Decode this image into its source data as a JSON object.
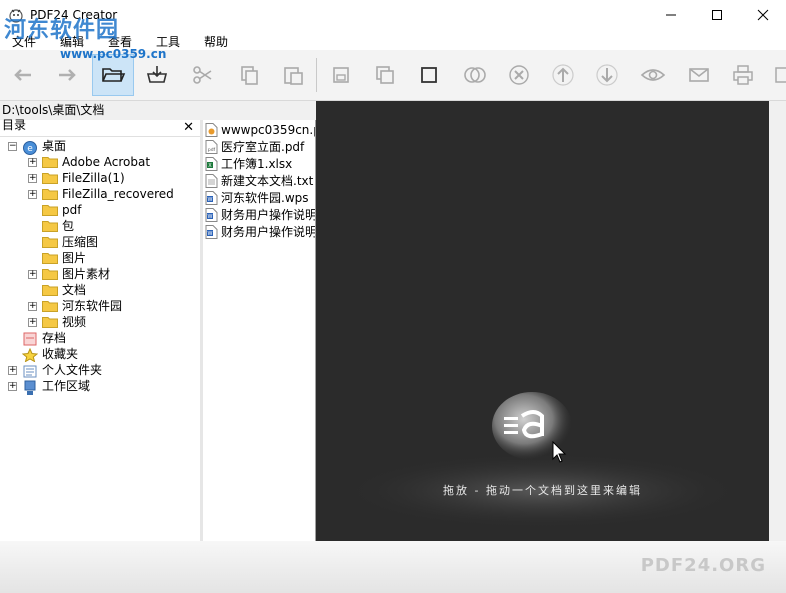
{
  "window": {
    "title": "PDF24 Creator",
    "watermark": "河东软件园",
    "watermark_url": "www.pc0359.cn"
  },
  "menu": [
    "文件",
    "编辑",
    "查看",
    "工具",
    "帮助"
  ],
  "path": "D:\\tools\\桌面\\文档",
  "tree": {
    "title": "目录",
    "close": "✕",
    "items": [
      {
        "label": "桌面"
      },
      {
        "label": "Adobe Acrobat"
      },
      {
        "label": "FileZilla(1)"
      },
      {
        "label": "FileZilla_recovered"
      },
      {
        "label": "pdf"
      },
      {
        "label": "包"
      },
      {
        "label": "压缩图"
      },
      {
        "label": "图片"
      },
      {
        "label": "图片素材"
      },
      {
        "label": "文档"
      },
      {
        "label": "河东软件园"
      },
      {
        "label": "视频"
      },
      {
        "label": "存档"
      },
      {
        "label": "收藏夹"
      },
      {
        "label": "个人文件夹"
      },
      {
        "label": "工作区域"
      }
    ]
  },
  "files": [
    {
      "label": "wwwpc0359cn.p",
      "icon": "html-file-icon"
    },
    {
      "label": "医疗室立面.pdf",
      "icon": "pdf-file-icon"
    },
    {
      "label": "工作簿1.xlsx",
      "icon": "excel-file-icon"
    },
    {
      "label": "新建文本文档.txt",
      "icon": "text-file-icon"
    },
    {
      "label": "河东软件园.wps",
      "icon": "doc-file-icon"
    },
    {
      "label": "财务用户操作说明",
      "icon": "doc-file-icon"
    },
    {
      "label": "财务用户操作说明",
      "icon": "doc-file-icon"
    }
  ],
  "preview": {
    "hint": "拖放 - 拖动一个文档到这里来编辑"
  },
  "brand": "PDF24.ORG",
  "colors": {
    "accent": "#1e74c9",
    "preview_bg": "#2b2b2b",
    "folder": "#f5c844"
  }
}
